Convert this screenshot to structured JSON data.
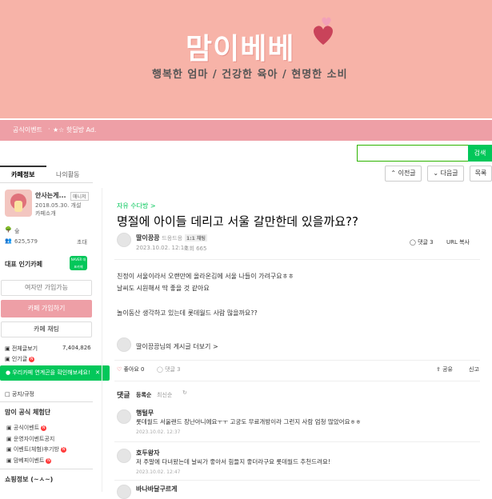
{
  "banner": {
    "title": "맘이베베",
    "subtitle": "행복한 엄마 / 건강한 육아 / 현명한 소비"
  },
  "nav": {
    "items": [
      "공식이벤트",
      "★☆ 핫딜방 Ad."
    ]
  },
  "search": {
    "placeholder": "",
    "button_label": "검색"
  },
  "toolbar": {
    "prev_label": "이전글",
    "next_label": "다음글",
    "list_label": "목록"
  },
  "sidebar": {
    "tabs": [
      "카페정보",
      "나의활동"
    ],
    "cafe_name": "안사는게...",
    "cafe_badge": "매니저",
    "since": "2018.05.30. 개설",
    "intro_link": "카페소개",
    "level": "숲",
    "members": "625,579",
    "invite": "초대",
    "rank_label": "대표 인기카페",
    "naver_badge": "NAVER 대표카페",
    "join_anyone": "여자만 가입가능",
    "join_button": "카페 가입하기",
    "chat_button": "카페 채팅",
    "total_posts_label": "전체글보기",
    "total_posts_count": "7,404,826",
    "popular_label": "인기글",
    "toast": "우리카페 연계곤을 확인해보세요!",
    "notice_label": "공지/규정",
    "section_title": "맘이 공식 체험단",
    "menu_items": [
      "공식이벤트",
      "운영자이벤트공지",
      "이벤트(체험)후기방",
      "맘베피이벤트"
    ],
    "shop_label": "쇼핑정보 (~ㅅ~)"
  },
  "post": {
    "board": "자유 수다방 >",
    "title": "명절에 아이들 데리고 서울 갈만한데 있을까요??",
    "author": "딸이끙끙",
    "author_suffix": "드응드응",
    "author_level": "1:1 채팅",
    "date": "2023.10.02. 12:10",
    "views": "조회 665",
    "comment_count": "댓글 3",
    "url_copy": "URL 복사",
    "body": [
      "친정이 서울이라서 오랜만에 올라온김에 서울 나들이 가려구요ㅎㅎ",
      "날씨도 시원해서 딱 좋을 것 같아요",
      "",
      "놀이동산 생각하고 있는데 롯데월드 사람 많을까요??"
    ],
    "author_more": "딸이끙끙님의 게시글 더보기 >",
    "likes": "좋아요 0",
    "like_button": "좋아요",
    "comments_button": "댓글 3",
    "share": "공유",
    "report": "신고"
  },
  "comments_section": {
    "title": "댓글",
    "sort_register": "등록순",
    "sort_latest": "최신순"
  },
  "comments": [
    {
      "name": "행털무",
      "text": "롯데월드 서울랜드 장난아니에요ㅜㅜ 고궁도 무료개방이라 그런지 사람 엄청 많았어요ㅎㅎ",
      "date": "2023.10.02. 12:37"
    },
    {
      "name": "호두왕자",
      "text": "저 주말에 다녀왔는데 날씨가 좋아서 힘들지 좋더라구요 롯데월드 추천드려요!",
      "date": "2023.10.02. 12:47"
    },
    {
      "name": "바나바달구르게",
      "text": "",
      "date": ""
    }
  ],
  "colors": {
    "banner_bg": "#f7b3a8",
    "nav_bg": "#ee9fa6",
    "accent_green": "#03c75a"
  }
}
